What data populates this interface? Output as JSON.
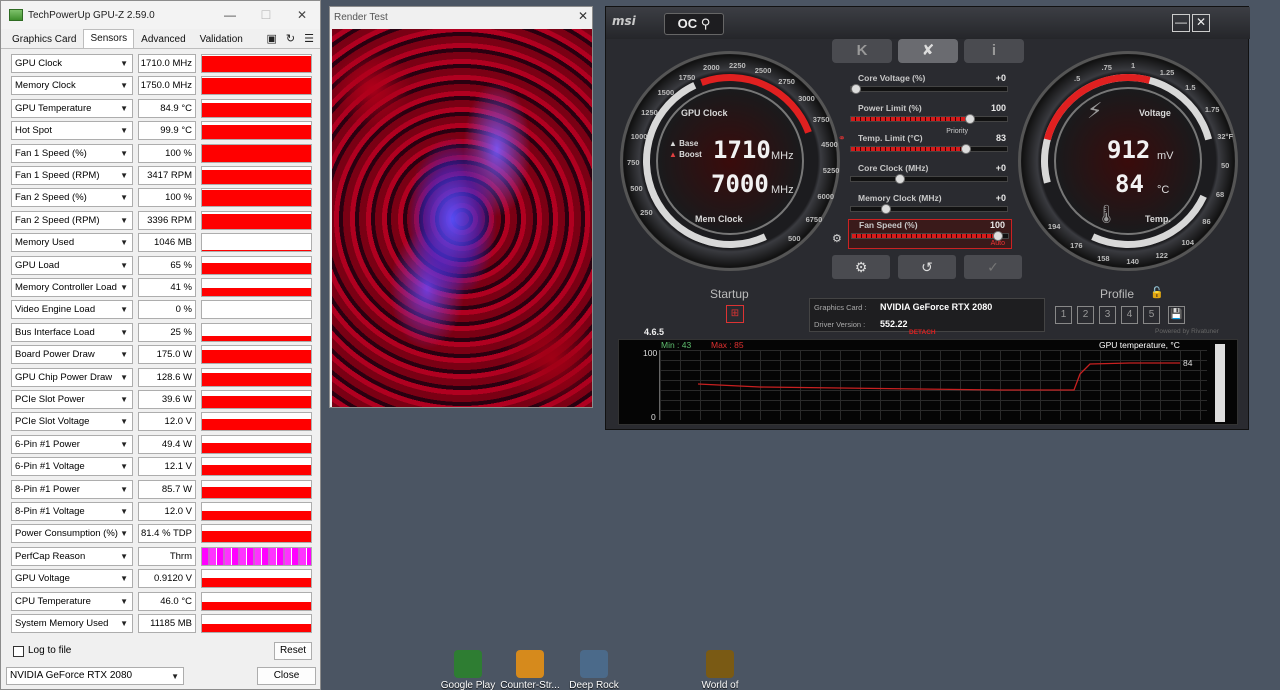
{
  "gpuz": {
    "title": "TechPowerUp GPU-Z 2.59.0",
    "tabs": [
      "Graphics Card",
      "Sensors",
      "Advanced",
      "Validation"
    ],
    "active_tab": "Sensors",
    "sensors": [
      {
        "name": "GPU Clock",
        "value": "1710.0 MHz",
        "level": 0.95
      },
      {
        "name": "Memory Clock",
        "value": "1750.0 MHz",
        "level": 0.95
      },
      {
        "name": "GPU Temperature",
        "value": "84.9 °C",
        "level": 0.8
      },
      {
        "name": "Hot Spot",
        "value": "99.9 °C",
        "level": 0.85
      },
      {
        "name": "Fan 1 Speed (%)",
        "value": "100 %",
        "level": 0.95
      },
      {
        "name": "Fan 1 Speed (RPM)",
        "value": "3417 RPM",
        "level": 0.85
      },
      {
        "name": "Fan 2 Speed (%)",
        "value": "100 %",
        "level": 0.95
      },
      {
        "name": "Fan 2 Speed (RPM)",
        "value": "3396 RPM",
        "level": 0.85
      },
      {
        "name": "Memory Used",
        "value": "1046 MB",
        "level": 0.1
      },
      {
        "name": "GPU Load",
        "value": "65 %",
        "level": 0.6
      },
      {
        "name": "Memory Controller Load",
        "value": "41 %",
        "level": 0.45
      },
      {
        "name": "Video Engine Load",
        "value": "0 %",
        "level": 0.0
      },
      {
        "name": "Bus Interface Load",
        "value": "25 %",
        "level": 0.3
      },
      {
        "name": "Board Power Draw",
        "value": "175.0 W",
        "level": 0.75
      },
      {
        "name": "GPU Chip Power Draw",
        "value": "128.6 W",
        "level": 0.72
      },
      {
        "name": "PCIe Slot Power",
        "value": "39.6 W",
        "level": 0.7
      },
      {
        "name": "PCIe Slot Voltage",
        "value": "12.0 V",
        "level": 0.7
      },
      {
        "name": "6-Pin #1 Power",
        "value": "49.4 W",
        "level": 0.6
      },
      {
        "name": "6-Pin #1 Voltage",
        "value": "12.1 V",
        "level": 0.6
      },
      {
        "name": "8-Pin #1 Power",
        "value": "85.7 W",
        "level": 0.6
      },
      {
        "name": "8-Pin #1 Voltage",
        "value": "12.0 V",
        "level": 0.55
      },
      {
        "name": "Power Consumption (%)",
        "value": "81.4 % TDP",
        "level": 0.65
      },
      {
        "name": "PerfCap Reason",
        "value": "Thrm",
        "level": 1.0,
        "pink": true
      },
      {
        "name": "GPU Voltage",
        "value": "0.9120 V",
        "level": 0.55
      },
      {
        "name": "CPU Temperature",
        "value": "46.0 °C",
        "level": 0.45
      },
      {
        "name": "System Memory Used",
        "value": "11185 MB",
        "level": 0.5
      }
    ],
    "log_label": "Log to file",
    "reset_label": "Reset",
    "gpu_select": "NVIDIA GeForce RTX 2080",
    "close_label": "Close"
  },
  "render": {
    "title": "Render Test"
  },
  "ab": {
    "logo": "msi",
    "oc_label": "OC",
    "tab_k": "K",
    "tab_i": "i",
    "gpu_clock_label": "GPU Clock",
    "mem_clock_label": "Mem Clock",
    "base_label": "Base",
    "boost_label": "Boost",
    "core_clock": "1710",
    "core_unit": "MHz",
    "mem_clock": "7000",
    "mem_unit": "MHz",
    "left_ticks": [
      "250",
      "500",
      "750",
      "1000",
      "1250",
      "1500",
      "1750",
      "2000",
      "2250",
      "2500",
      "2750",
      "3000",
      "3750",
      "4500",
      "5250",
      "6000",
      "6750",
      "500"
    ],
    "voltage_label": "Voltage",
    "temp_label": "Temp.",
    "voltage_value": "912",
    "voltage_unit": "mV",
    "temp_value": "84",
    "temp_unit": "°C",
    "right_ticks": [
      ".5",
      ".75",
      "1",
      "1.25",
      "1.5",
      "1.75",
      "32°F",
      "50",
      "68",
      "86",
      "104",
      "122",
      "140",
      "158",
      "176",
      "194"
    ],
    "sliders": [
      {
        "label": "Core Voltage (%)",
        "value": "+0",
        "pos": 0.0,
        "red": 0.0
      },
      {
        "label": "Power Limit (%)",
        "value": "100",
        "pos": 0.77,
        "red": 0.77
      },
      {
        "label": "Temp. Limit (°C)",
        "value": "83",
        "pos": 0.74,
        "red": 0.74,
        "extra": "Priority"
      },
      {
        "label": "Core Clock (MHz)",
        "value": "+0",
        "pos": 0.3,
        "red": 0.0
      },
      {
        "label": "Memory Clock (MHz)",
        "value": "+0",
        "pos": 0.2,
        "red": 0.0
      },
      {
        "label": "Fan Speed (%)",
        "value": "100",
        "pos": 0.95,
        "red": 0.95,
        "extra": "Auto"
      }
    ],
    "startup_label": "Startup",
    "profile_label": "Profile",
    "profiles": [
      "1",
      "2",
      "3",
      "4",
      "5"
    ],
    "graphics_card_key": "Graphics Card :",
    "graphics_card_value": "NVIDIA GeForce RTX 2080",
    "driver_key": "Driver Version :",
    "driver_value": "552.22",
    "detach_label": "DETACH",
    "powered_by": "Powered by Rivatuner",
    "version": "4.6.5",
    "monitor": {
      "min_label": "Min : 43",
      "max_label": "Max : 85",
      "y_top": "100",
      "y_bottom": "0",
      "series_title": "GPU temperature, °C",
      "current": "84"
    }
  },
  "desktop_icons": [
    {
      "label": "Google Play",
      "color": "#2e7d32"
    },
    {
      "label": "Counter-Str...",
      "color": "#d68a1c"
    },
    {
      "label": "Deep Rock",
      "color": "#4b6a8a"
    },
    {
      "label": "World of",
      "color": "#7a5a14"
    }
  ]
}
